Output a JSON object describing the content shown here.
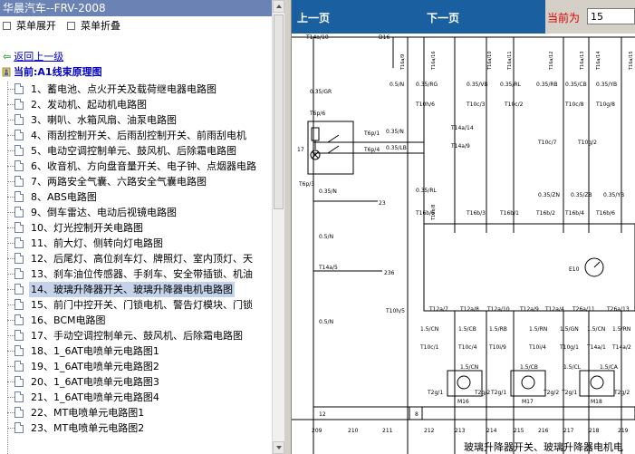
{
  "window": {
    "title": "华晨汽车--FRV-2008"
  },
  "toolbar_left": {
    "expand_label": "菜单展开",
    "collapse_label": "菜单折叠"
  },
  "nav": {
    "back_label": "返回上一级",
    "current_label": "当前:A1线束原理图"
  },
  "tree": {
    "items": [
      {
        "label": "1、蓄电池、点火开关及载荷继电器电路图"
      },
      {
        "label": "2、发动机、起动机电路图"
      },
      {
        "label": "3、喇叭、水箱风扇、油泵电路图"
      },
      {
        "label": "4、雨刮控制开关、后雨刮控制开关、前雨刮电机"
      },
      {
        "label": "5、电动空调控制单元、鼓风机、后除霜电路图"
      },
      {
        "label": "6、收音机、方向盘音量开关、电子钟、点烟器电路"
      },
      {
        "label": "7、两路安全气囊、六路安全气囊电路图"
      },
      {
        "label": "8、ABS电路图"
      },
      {
        "label": "9、倒车雷达、电动后视镜电路图"
      },
      {
        "label": "10、灯光控制开关电路图"
      },
      {
        "label": "11、前大灯、侧转向灯电路图"
      },
      {
        "label": "12、后尾灯、高位刹车灯、牌照灯、室内顶灯、天"
      },
      {
        "label": "13、刹车油位传感器、手刹车、安全带插锁、机油"
      },
      {
        "label": "14、玻璃升降器开关、玻璃升降器电机电路图"
      },
      {
        "label": "15、前门中控开关、门锁电机、警告灯模块、门锁"
      },
      {
        "label": "16、BCM电路图"
      },
      {
        "label": "17、手动空调控制单元、鼓风机、后除霜电路图"
      },
      {
        "label": "18、1_6AT电喷单元电路图1"
      },
      {
        "label": "19、1_6AT电喷单元电路图2"
      },
      {
        "label": "20、1_6AT电喷单元电路图3"
      },
      {
        "label": "21、1_6AT电喷单元电路图4"
      },
      {
        "label": "22、MT电喷单元电路图1"
      },
      {
        "label": "23、MT电喷单元电路图2"
      }
    ],
    "selected_index": 13
  },
  "viewer": {
    "prev_label": "上一页",
    "next_label": "下一页",
    "page_label": "当前为",
    "page_value": "15",
    "caption": "玻璃升降器开关、玻璃升降器电机电",
    "diagram": {
      "labels": {
        "t14a10": "T14a/10",
        "d16": "D16",
        "t16a9": "T16a/9",
        "t16a16": "T16a/16",
        "t16a10": "T16a/10",
        "t16a11": "T16a/11",
        "t16a12": "T16a/12",
        "t16a13": "T16a/13",
        "t16a14": "T16a/14",
        "t16a15": "T16a/15",
        "w035gr": "0.35/GR",
        "w05n_a": "0.5/N",
        "w035rg": "0.35/RG",
        "w035vb": "0.35/VB",
        "w035rl": "0.35/RL",
        "w035rb": "0.35/RB",
        "w035cb": "0.35/CB",
        "w035yb": "0.35/YB",
        "t6p6": "T6p/6",
        "t10h6": "T10h/6",
        "t10c3": "T10c/3",
        "t10c2": "T10c/2",
        "t10c8": "T10c/8",
        "t10g8": "T10g/8",
        "t14a14": "T14a/14",
        "t14a9": "T14a/9",
        "t6p1": "T6p/1",
        "t6p4": "T6p/4",
        "w035n": "0.35/N",
        "w035lb": "0.35/LB",
        "n17": "17",
        "t10c7": "T10c/7",
        "t10g2": "T10g/2",
        "t6p3": "T6p/3",
        "w035n2": "0.35/N",
        "n23": "23",
        "w035rl2": "0.35/RL",
        "w035zn": "0.35/ZN",
        "w035zb": "0.35/ZB",
        "w035yb2": "0.35/YB",
        "t16b5": "T16b/5",
        "t16b3": "T16b/3",
        "t16b1": "T16b/1",
        "t16b2": "T16b/2",
        "t16b4": "T16b/4",
        "t16b6": "T16b/6",
        "t16b8": "T16b/8",
        "w05n_b": "0.5/N",
        "t14a5": "T14a/5",
        "n236": "236",
        "e10": "E10",
        "t10h5": "T10h/5",
        "w05n_c": "0.5/N",
        "t12a7": "T12a/7",
        "t12a8": "T12a/8",
        "t12a10": "T12a/10",
        "t12a9": "T12a/9",
        "t12a4": "T12a/4",
        "t26a11": "T26a/11",
        "t26a13": "T26a/13",
        "w15cn": "1.5/CN",
        "w15cb": "1.5/CB",
        "w15rb": "1.5/RB",
        "w15rn": "1.5/RN",
        "w15gn": "1.5/GN",
        "w15cn2": "1.5/CN",
        "w15rn2": "1.5/RN",
        "t10c1": "T10c/1",
        "t10c4": "T10c/4",
        "t10i9": "T10i/9",
        "t10i4": "T10i/4",
        "t10g1": "T10g/1",
        "t14a1": "T14a/1",
        "t14a2": "T14a/2",
        "w15cn3": "1.5/CN",
        "w15cb2": "1.5/CB",
        "w15cl": "1.5/CL",
        "w15ca": "1.5/CA",
        "t2g1a": "T2g/1",
        "t2g2a": "T2g/2",
        "t2g1b": "T2g/1",
        "t2g2b": "T2g/2",
        "t2g1c": "T2g/1",
        "t2g2c": "T2g/2",
        "m16": "M16",
        "m17": "M17",
        "m18": "M18",
        "n12": "12",
        "n8": "8",
        "col209": "209",
        "col210": "210",
        "col211": "211",
        "col212": "212",
        "col213": "213",
        "col214": "214",
        "col215": "215",
        "col216": "216",
        "col217": "217",
        "col218": "218",
        "col219": "219"
      }
    }
  }
}
